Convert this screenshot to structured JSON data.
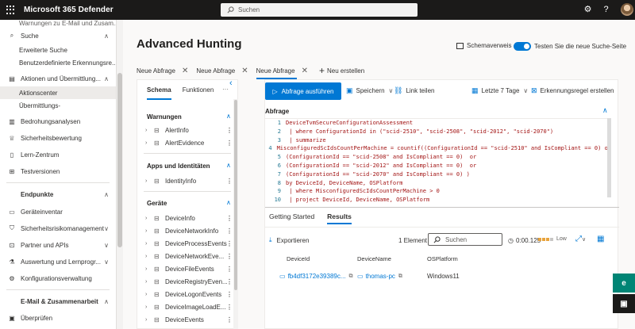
{
  "topbar": {
    "title": "Microsoft 365 Defender",
    "search_placeholder": "Suchen",
    "icons": [
      "waffle-icon",
      "settings-icon",
      "help-icon",
      "avatar"
    ]
  },
  "nav": {
    "items": [
      {
        "label": "Warnungen zu E-Mail und Zusam...",
        "icon": "",
        "chevron": ""
      },
      {
        "label": "Suche",
        "icon": "search",
        "chevron": "up"
      },
      {
        "label": "Erweiterte Suche",
        "sub": true
      },
      {
        "label": "Benutzerdefinierte Erkennungsre...",
        "sub": true
      },
      {
        "label": "Aktionen und Übermittlung...",
        "icon": "clipboard",
        "chevron": "up"
      },
      {
        "label": "Aktionscenter",
        "sub": true,
        "selected": true
      },
      {
        "label": "Übermittlungs-",
        "sub": true
      },
      {
        "label": "Bedrohungsanalysen",
        "icon": "chart"
      },
      {
        "label": "Sicherheitsbewertung",
        "icon": "trophy"
      },
      {
        "label": "Lern-Zentrum",
        "icon": "book"
      },
      {
        "label": "Testversionen",
        "icon": "gift"
      },
      {
        "label": "Endpunkte",
        "icon": "",
        "chevron": "up",
        "bold": true
      },
      {
        "label": "Geräteinventar",
        "icon": "device"
      },
      {
        "label": "Sicherheitsrisikomanagement",
        "icon": "shield",
        "chevron": "down"
      },
      {
        "label": "Partner und APIs",
        "icon": "plug",
        "chevron": "down"
      },
      {
        "label": "Auswertung und Lernprogr...",
        "icon": "flask",
        "chevron": "down"
      },
      {
        "label": "Konfigurationsverwaltung",
        "icon": "gear"
      },
      {
        "label": "E-Mail & Zusammenarbeit",
        "icon": "",
        "chevron": "up",
        "bold": true
      },
      {
        "label": "Überprüfen",
        "icon": "review"
      }
    ]
  },
  "page": {
    "title": "Advanced Hunting",
    "schema_view_label": "Schemaverweis",
    "toggle_label": "Testen Sie die neue Suche-Seite",
    "query_tabs": [
      "Neue Abfrage",
      "Neue Abfrage",
      "Neue Abfrage"
    ],
    "new_tab_label": "Neu erstellen"
  },
  "schema": {
    "tabs": [
      "Schema",
      "Funktionen"
    ],
    "more": "···",
    "sections": [
      {
        "title": "Warnungen",
        "tables": [
          "AlertInfo",
          "AlertEvidence"
        ]
      },
      {
        "title": "Apps und Identitäten",
        "tables": [
          "IdentityInfo"
        ]
      },
      {
        "title": "Geräte",
        "tables": [
          "DeviceInfo",
          "DeviceNetworkInfo",
          "DeviceProcessEvents",
          "DeviceNetworkEve...",
          "DeviceFileEvents",
          "DeviceRegistryEven...",
          "DeviceLogonEvents",
          "DeviceImageLoadE...",
          "DeviceEvents"
        ]
      }
    ]
  },
  "toolbar": {
    "run_label": "Abfrage ausführen",
    "save_label": "Speichern",
    "share_label": "Link teilen",
    "time_label": "Letzte 7 Tage",
    "rule_label": "Erkennungsregel erstellen"
  },
  "query": {
    "label": "Abfrage",
    "lines": [
      {
        "n": "1",
        "t": "DeviceTvmSecureConfigurationAssessment"
      },
      {
        "n": "2",
        "t": " | where ConfigurationId in (\"scid-2510\", \"scid-2508\", \"scid-2012\", \"scid-2070\")"
      },
      {
        "n": "3",
        "t": " | summarize"
      },
      {
        "n": "4",
        "t": "MisconfiguredScIdsCountPerMachine = countif((ConfigurationId == \"scid-2510\" and IsCompliant == 0) or"
      },
      {
        "n": "5",
        "t": "(ConfigurationId == \"scid-2508\" and IsCompliant == 0)  or"
      },
      {
        "n": "6",
        "t": "(ConfigurationId == \"scid-2012\" and IsCompliant == 0)  or"
      },
      {
        "n": "7",
        "t": "(ConfigurationId == \"scid-2070\" and IsCompliant == 0) )"
      },
      {
        "n": "8",
        "t": "by DeviceId, DeviceName, OSPlatform"
      },
      {
        "n": "9",
        "t": " | where MisconfiguredScIdsCountPerMachine > 0"
      },
      {
        "n": "10",
        "t": " | project DeviceId, DeviceName, OSPlatform"
      }
    ]
  },
  "results": {
    "tabs": [
      "Getting Started",
      "Results"
    ],
    "export_label": "Exportieren",
    "count_label": "1 Element",
    "search_placeholder": "Suchen",
    "time": "0:00.125",
    "low_label": "Low",
    "columns": [
      "DeviceId",
      "DeviceName",
      "OSPlatform"
    ],
    "rows": [
      {
        "device_id": "fb4df3172e39389c...",
        "device_name": "thomas-pc",
        "os": "Windows11"
      }
    ]
  },
  "colors": {
    "accent": "#0078d4",
    "topbar": "#1b1a19",
    "side_teal": "#008575",
    "side_dark": "#1b1a19"
  }
}
